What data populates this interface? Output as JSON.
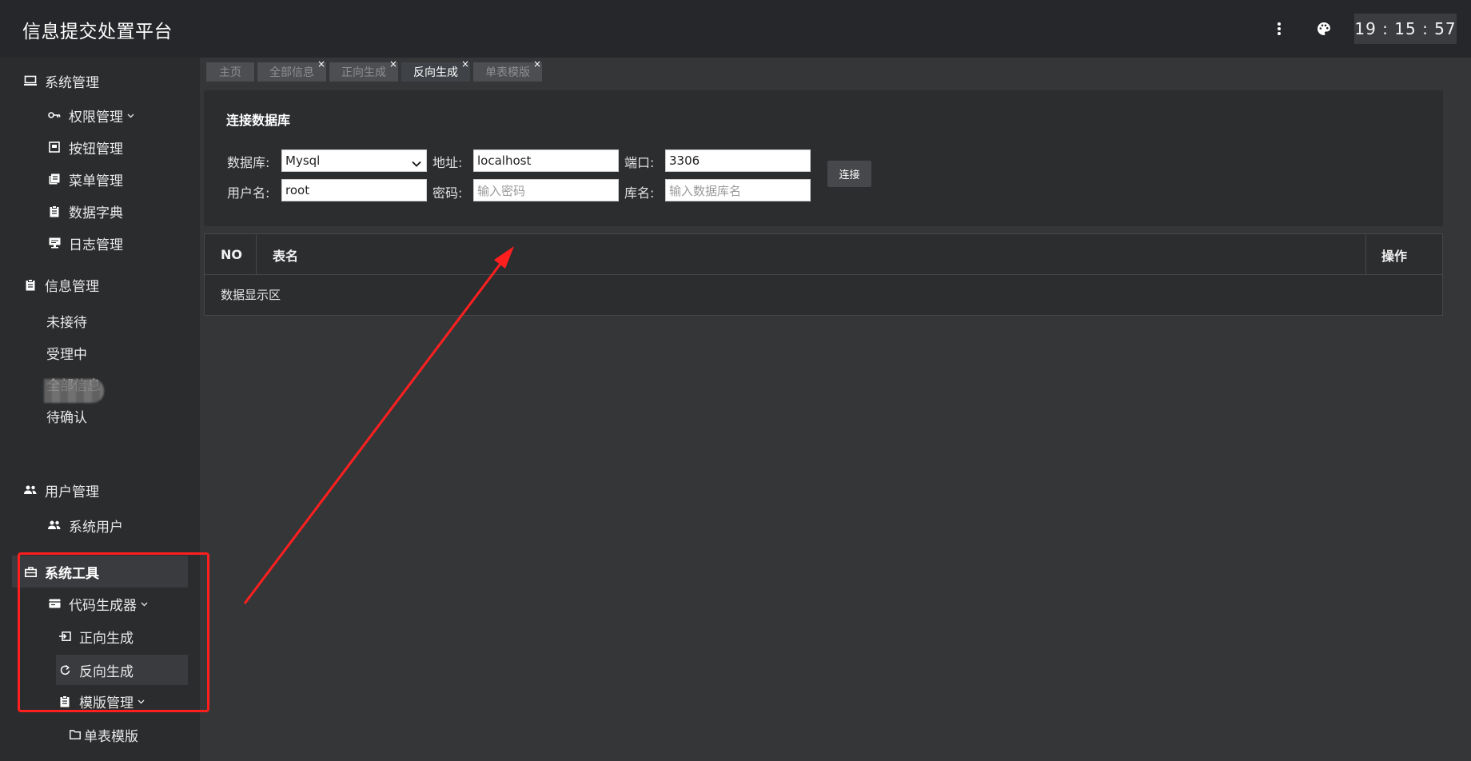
{
  "header": {
    "app_title": "信息提交处置平台",
    "clock": "19 : 15 : 57",
    "more_icon": "more-vertical-icon",
    "palette_icon": "palette-icon"
  },
  "sidebar": {
    "groups": [
      {
        "label": "系统管理",
        "icon": "monitor-icon"
      },
      {
        "label": "信息管理",
        "icon": "clipboard-icon"
      },
      {
        "label": "用户管理",
        "icon": "users-icon"
      },
      {
        "label": "系统工具",
        "icon": "toolbox-icon"
      }
    ],
    "items": {
      "perm": "权限管理",
      "button": "按钮管理",
      "menu": "菜单管理",
      "dict": "数据字典",
      "log": "日志管理",
      "pending": "未接待",
      "processing": "受理中",
      "allinfo": "全部信息",
      "toconfirm": "待确认",
      "sysuser": "系统用户",
      "codegen": "代码生成器",
      "forward": "正向生成",
      "reverse": "反向生成",
      "template": "模版管理",
      "single": "单表模版"
    }
  },
  "tabs": [
    {
      "label": "主页",
      "closable": false,
      "active": false
    },
    {
      "label": "全部信息",
      "closable": true,
      "active": false
    },
    {
      "label": "正向生成",
      "closable": true,
      "active": false
    },
    {
      "label": "反向生成",
      "closable": true,
      "active": true
    },
    {
      "label": "单表模版",
      "closable": true,
      "active": false
    }
  ],
  "tab_close_glyph": "×",
  "connect": {
    "title": "连接数据库",
    "db_label": "数据库:",
    "db_value": "Mysql",
    "addr_label": "地址:",
    "addr_value": "localhost",
    "port_label": "端口:",
    "port_value": "3306",
    "user_label": "用户名:",
    "user_value": "root",
    "pwd_label": "密码:",
    "pwd_placeholder": "输入密码",
    "dbname_label": "库名:",
    "dbname_placeholder": "输入数据库名",
    "button": "连接"
  },
  "table": {
    "columns": [
      "NO",
      "表名",
      "操作"
    ],
    "empty_text": "数据显示区"
  },
  "colors": {
    "annotation": "#ff1f1f"
  }
}
